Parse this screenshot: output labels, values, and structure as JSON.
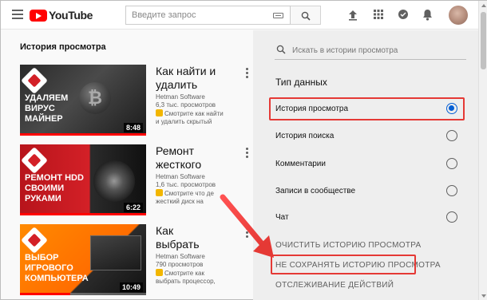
{
  "header": {
    "brand": "YouTube",
    "search_placeholder": "Введите запрос"
  },
  "page_title": "История просмотра",
  "videos": [
    {
      "title": "Как найти и\nудалить",
      "channel": "Hetman Software",
      "views": "6,3 тыс. просмотров",
      "desc1": "Смотрите как найти",
      "desc2": "и удалить скрытый",
      "duration": "8:48",
      "thumb_text": "УДАЛЯЕМ\nВИРУС\nМАЙНЕР",
      "progress": 1.0
    },
    {
      "title": "Ремонт\nжесткого",
      "channel": "Hetman Software",
      "views": "1,6 тыс. просмотров",
      "desc1": "Смотрите что де",
      "desc2": "жесткий диск на",
      "duration": "6:22",
      "thumb_text": "РЕМОНТ HDD\nСВОИМИ\nРУКАМИ",
      "progress": 1.0
    },
    {
      "title": "Как\nвыбрать",
      "channel": "Hetman Software",
      "views": "790 просмотров",
      "desc1": "Смотрите как",
      "desc2": "выбрать процессор,",
      "duration": "10:49",
      "thumb_text": "ВЫБОР\nИГРОВОГО\nКОМПЬЮТЕРА",
      "progress": 0.4
    }
  ],
  "sidebar": {
    "search_placeholder": "Искать в истории просмотра",
    "data_type_heading": "Тип данных",
    "options": [
      {
        "label": "История просмотра",
        "checked": true
      },
      {
        "label": "История поиска",
        "checked": false
      },
      {
        "label": "Комментарии",
        "checked": false
      },
      {
        "label": "Записи в сообществе",
        "checked": false
      },
      {
        "label": "Чат",
        "checked": false
      }
    ],
    "actions": [
      "ОЧИСТИТЬ ИСТОРИЮ ПРОСМОТРА",
      "НЕ СОХРАНЯТЬ ИСТОРИЮ ПРОСМОТРА",
      "ОТСЛЕЖИВАНИЕ ДЕЙСТВИЙ"
    ]
  },
  "colors": {
    "accent_red": "#ff0000",
    "radio_blue": "#065fd4",
    "highlight_red": "#e53935"
  }
}
